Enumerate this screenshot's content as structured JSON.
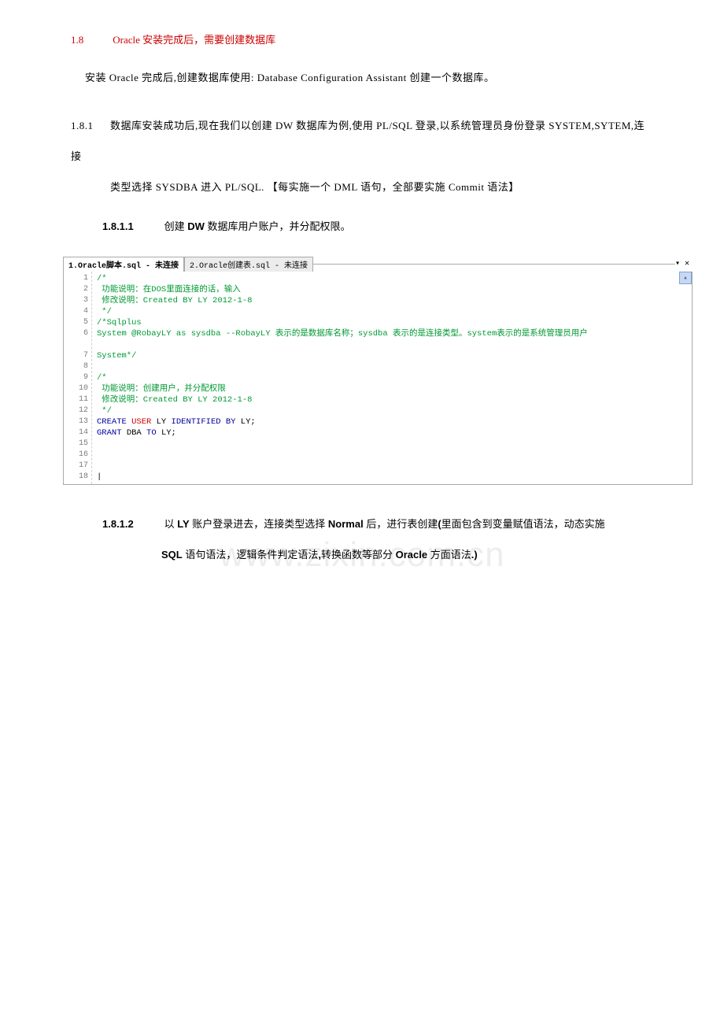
{
  "section": {
    "num": "1.8",
    "title": "Oracle 安装完成后，需要创建数据库"
  },
  "para1": "安装 Oracle 完成后,创建数据库使用: Database Configuration Assistant 创建一个数据库。",
  "subsec": {
    "num": "1.8.1",
    "line1": "数据库安装成功后,现在我们以创建 DW 数据库为例,使用 PL/SQL 登录,以系统管理员身份登录 SYSTEM,SYTEM,连接",
    "line2": "类型选择 SYSDBA 进入 PL/SQL. 【每实施一个 DML 语句，全部要实施 Commit 语法】"
  },
  "h1811": {
    "num": "1.8.1.1",
    "textA": "创建 ",
    "bold": "DW",
    "textB": " 数据库用户账户，并分配权限。"
  },
  "tabs": {
    "t1": "1.Oracle脚本.sql - 未连接",
    "t2": "2.Oracle创建表.sql - 未连接"
  },
  "code": {
    "l1": "/*",
    "l2": " 功能说明：在DOS里面连接的话，输入",
    "l3": " 修改说明：Created BY LY 2012-1-8",
    "l4": " */",
    "l5": "/*Sqlplus",
    "l6": "System @RobayLY as sysdba   --RobayLY 表示的是数据库名称；sysdba 表示的是连接类型。system表示的是系统管理员用户",
    "l7": "System*/",
    "l9": "/*",
    "l10": " 功能说明：创建用户，并分配权限",
    "l11": " 修改说明：Created BY LY 2012-1-8",
    "l12": " */",
    "l13a": "CREATE ",
    "l13b": "USER",
    "l13c": " LY ",
    "l13d": "IDENTIFIED BY",
    "l13e": " LY;",
    "l14a": "GRANT",
    "l14b": " DBA ",
    "l14c": "TO",
    "l14d": " LY;"
  },
  "h1812": {
    "num": "1.8.1.2",
    "p1a": "以 ",
    "p1b": "LY",
    "p1c": " 账户登录进去，连接类型选择 ",
    "p1d": "Normal",
    "p1e": " 后，进行表创建",
    "p1f": "(",
    "p1g": "里面包含到变量赋值语法，动态实施",
    "p2a": "SQL",
    "p2b": " 语句语法，逻辑条件判定语法",
    "p2c": ",",
    "p2d": "转换函数等部分 ",
    "p2e": "Oracle",
    "p2f": " 方面语法",
    "p2g": ".)"
  },
  "watermark": "www.zixin.com.cn"
}
